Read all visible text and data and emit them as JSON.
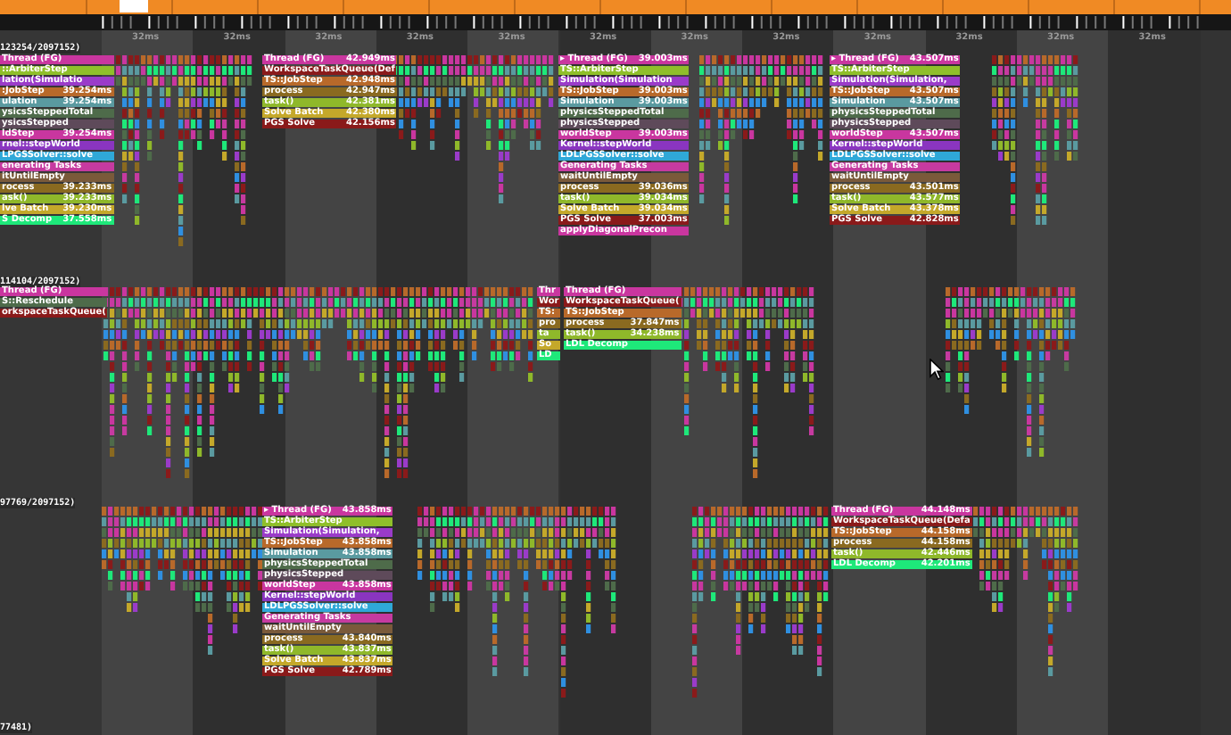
{
  "ruler": {
    "labels": [
      "32ms",
      "32ms",
      "32ms",
      "32ms",
      "32ms",
      "32ms",
      "32ms",
      "32ms",
      "32ms",
      "32ms",
      "32ms",
      "32ms"
    ]
  },
  "threads": [
    {
      "header": "123254/2097152)",
      "stacks": [
        {
          "blocks": [
            {
              "name": "Thread (FG)",
              "color": "#c9369f"
            },
            {
              "name": "::ArbiterStep",
              "color": "#8fbf2a"
            },
            {
              "name": "lation(Simulatio",
              "color": "#9a3bc9"
            },
            {
              "name": ":JobStep",
              "time": "39.254ms",
              "color": "#b8692a"
            },
            {
              "name": "ulation",
              "time": "39.254ms",
              "color": "#5a9aa0"
            },
            {
              "name": "ysicsSteppedTotal",
              "color": "#4e6b4a"
            },
            {
              "name": "ysicsStepped",
              "color": "#5e4a5a"
            },
            {
              "name": "ldStep",
              "time": "39.254ms",
              "color": "#c9369f"
            },
            {
              "name": "rnel::stepWorld",
              "color": "#8a35c0"
            },
            {
              "name": "LPGSSolver::solve",
              "color": "#2fa8d8"
            },
            {
              "name": "enerating Tasks",
              "color": "#c63aa0"
            },
            {
              "name": "itUntilEmpty",
              "color": "#7a5a3a"
            },
            {
              "name": "rocess",
              "time": "39.233ms",
              "color": "#8a6a20"
            },
            {
              "name": "ask()",
              "time": "39.233ms",
              "color": "#8fb82a"
            },
            {
              "name": "lve Batch",
              "time": "39.230ms",
              "color": "#c4a82a"
            },
            {
              "name": "S Decomp",
              "time": "37.558ms",
              "color": "#1ee87a"
            }
          ]
        },
        {
          "blocks": [
            {
              "name": "Thread (FG)",
              "time": "42.949ms",
              "color": "#c9369f"
            },
            {
              "name": "WorkspaceTaskQueue(Def",
              "color": "#8a1a1a"
            },
            {
              "name": "TS::JobStep",
              "time": "42.948ms",
              "color": "#b8692a"
            },
            {
              "name": "process",
              "time": "42.947ms",
              "color": "#8a6a20"
            },
            {
              "name": "task()",
              "time": "42.381ms",
              "color": "#8fb82a"
            },
            {
              "name": "Solve Batch",
              "time": "42.380ms",
              "color": "#c4a82a"
            },
            {
              "name": "PGS Solve",
              "time": "42.156ms",
              "color": "#8a1a1a"
            }
          ]
        },
        {
          "blocks": [
            {
              "name": "▸ Thread (FG)",
              "time": "39.003ms",
              "color": "#c9369f"
            },
            {
              "name": "TS::ArbiterStep",
              "color": "#8fbf2a"
            },
            {
              "name": "Simulation(Simulation",
              "color": "#9a3bc9"
            },
            {
              "name": "TS::JobStep",
              "time": "39.003ms",
              "color": "#b8692a"
            },
            {
              "name": "Simulation",
              "time": "39.003ms",
              "color": "#5a9aa0"
            },
            {
              "name": "physicsSteppedTotal",
              "color": "#4e6b4a"
            },
            {
              "name": "physicsStepped",
              "color": "#5e4a5a"
            },
            {
              "name": "worldStep",
              "time": "39.003ms",
              "color": "#c9369f"
            },
            {
              "name": "Kernel::stepWorld",
              "color": "#8a35c0"
            },
            {
              "name": "LDLPGSSolver::solve",
              "color": "#2fa8d8"
            },
            {
              "name": "Generating Tasks",
              "color": "#c63aa0"
            },
            {
              "name": "waitUntilEmpty",
              "color": "#7a5a3a"
            },
            {
              "name": "process",
              "time": "39.036ms",
              "color": "#8a6a20"
            },
            {
              "name": "task()",
              "time": "39.034ms",
              "color": "#8fb82a"
            },
            {
              "name": "Solve Batch",
              "time": "39.034ms",
              "color": "#c4a82a"
            },
            {
              "name": "PGS Solve",
              "time": "37.003ms",
              "color": "#8a1a1a"
            },
            {
              "name": "applyDiagonalPrecon",
              "color": "#c9369f"
            }
          ]
        },
        {
          "blocks": [
            {
              "name": "▸ Thread (FG)",
              "time": "43.507ms",
              "color": "#c9369f"
            },
            {
              "name": "TS::ArbiterStep",
              "color": "#8fbf2a"
            },
            {
              "name": "Simulation(Simulation,",
              "color": "#9a3bc9"
            },
            {
              "name": "TS::JobStep",
              "time": "43.507ms",
              "color": "#b8692a"
            },
            {
              "name": "Simulation",
              "time": "43.507ms",
              "color": "#5a9aa0"
            },
            {
              "name": "physicsSteppedTotal",
              "color": "#4e6b4a"
            },
            {
              "name": "physicsStepped",
              "color": "#5e4a5a"
            },
            {
              "name": "worldStep",
              "time": "43.507ms",
              "color": "#c9369f"
            },
            {
              "name": "Kernel::stepWorld",
              "color": "#8a35c0"
            },
            {
              "name": "LDLPGSSolver::solve",
              "color": "#2fa8d8"
            },
            {
              "name": "Generating Tasks",
              "color": "#c63aa0"
            },
            {
              "name": "waitUntilEmpty",
              "color": "#7a5a3a"
            },
            {
              "name": "process",
              "time": "43.501ms",
              "color": "#8a6a20"
            },
            {
              "name": "task()",
              "time": "43.577ms",
              "color": "#8fb82a"
            },
            {
              "name": "Solve Batch",
              "time": "43.378ms",
              "color": "#c4a82a"
            },
            {
              "name": "PGS Solve",
              "time": "42.828ms",
              "color": "#8a1a1a"
            }
          ]
        }
      ]
    },
    {
      "header": "114104/2097152)",
      "stacks": [
        {
          "blocks": [
            {
              "name": "Thread (FG)",
              "color": "#c9369f"
            },
            {
              "name": "S::Reschedule",
              "color": "#4e6b4a"
            },
            {
              "name": "orkspaceTaskQueue(",
              "color": "#8a1a1a"
            }
          ]
        },
        {
          "blocks": [
            {
              "name": "Thr",
              "color": "#c9369f"
            },
            {
              "name": "Wor",
              "color": "#8a1a1a"
            },
            {
              "name": "TS:",
              "color": "#b8692a"
            },
            {
              "name": "pro",
              "color": "#8a6a20"
            },
            {
              "name": "ta",
              "color": "#8fb82a"
            },
            {
              "name": "So",
              "color": "#c4a82a"
            },
            {
              "name": "LD",
              "color": "#1ee87a"
            }
          ]
        },
        {
          "blocks": [
            {
              "name": "Thread (FG)",
              "color": "#c9369f"
            },
            {
              "name": "WorkspaceTaskQueue(",
              "color": "#8a1a1a"
            },
            {
              "name": "TS::JobStep",
              "color": "#b8692a"
            },
            {
              "name": "process",
              "time": "37.847ms",
              "color": "#8a6a20"
            },
            {
              "name": "task()",
              "time": "34.238ms",
              "color": "#8fb82a"
            },
            {
              "name": "LDL Decomp",
              "color": "#1ee87a"
            }
          ]
        }
      ]
    },
    {
      "header": "97769/2097152)",
      "stacks": [
        {
          "blocks": [
            {
              "name": "▸ Thread (FG)",
              "time": "43.858ms",
              "color": "#c9369f"
            },
            {
              "name": "TS::ArbiterStep",
              "color": "#8fbf2a"
            },
            {
              "name": "Simulation(Simulation,",
              "color": "#9a3bc9"
            },
            {
              "name": "TS::JobStep",
              "time": "43.858ms",
              "color": "#b8692a"
            },
            {
              "name": "Simulation",
              "time": "43.858ms",
              "color": "#5a9aa0"
            },
            {
              "name": "physicsSteppedTotal",
              "color": "#4e6b4a"
            },
            {
              "name": "physicsStepped",
              "color": "#5e4a5a"
            },
            {
              "name": "worldStep",
              "time": "43.858ms",
              "color": "#c9369f"
            },
            {
              "name": "Kernel::stepWorld",
              "color": "#8a35c0"
            },
            {
              "name": "LDLPGSSolver::solve",
              "color": "#2fa8d8"
            },
            {
              "name": "Generating Tasks",
              "color": "#c63aa0"
            },
            {
              "name": "waitUntilEmpty",
              "color": "#7a5a3a"
            },
            {
              "name": "process",
              "time": "43.840ms",
              "color": "#8a6a20"
            },
            {
              "name": "task()",
              "time": "43.837ms",
              "color": "#8fb82a"
            },
            {
              "name": "Solve Batch",
              "time": "43.837ms",
              "color": "#c4a82a"
            },
            {
              "name": "PGS Solve",
              "time": "42.789ms",
              "color": "#8a1a1a"
            }
          ]
        },
        {
          "blocks": [
            {
              "name": "Thread (FG)",
              "time": "44.148ms",
              "color": "#c9369f"
            },
            {
              "name": "WorkspaceTaskQueue(Defa",
              "color": "#8a1a1a"
            },
            {
              "name": "TS::JobStep",
              "time": "44.158ms",
              "color": "#b8692a"
            },
            {
              "name": "process",
              "time": "44.158ms",
              "color": "#8a6a20"
            },
            {
              "name": "task()",
              "time": "42.446ms",
              "color": "#8fb82a"
            },
            {
              "name": "LDL Decomp",
              "time": "42.201ms",
              "color": "#1ee87a"
            }
          ]
        }
      ]
    },
    {
      "header": "77481)"
    }
  ]
}
